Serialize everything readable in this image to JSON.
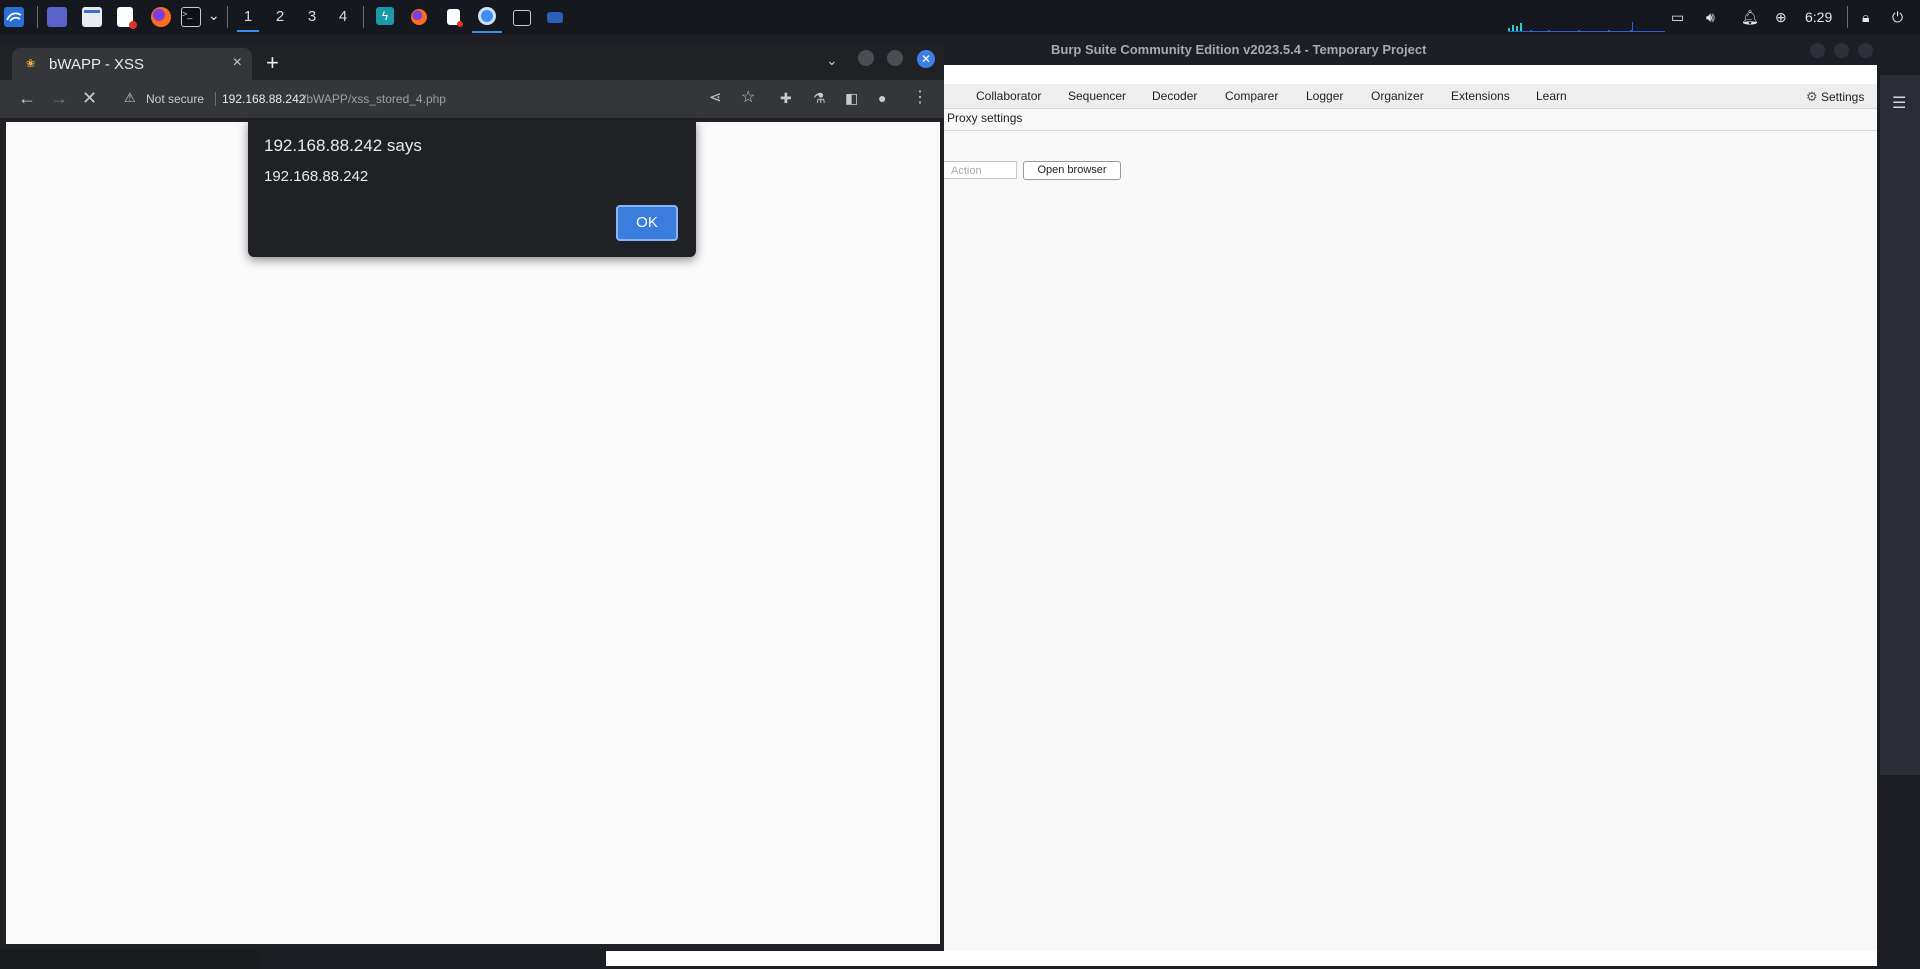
{
  "taskbar": {
    "workspaces": [
      "1",
      "2",
      "3",
      "4"
    ],
    "active_workspace": "1",
    "clock": "6:29",
    "launcher_icons": [
      "kali-menu-icon",
      "desktop-icon",
      "file-manager-icon",
      "text-editor-icon",
      "firefox-icon",
      "terminal-icon"
    ],
    "window_icons": [
      "burp-icon",
      "firefox-window-icon",
      "editor-window-icon",
      "chromium-window-icon",
      "terminal-window-icon",
      "folder-window-icon"
    ],
    "tray_icons": [
      "display-icon",
      "volume-icon",
      "bell-icon",
      "power-manager-icon",
      "lock-icon",
      "logout-icon"
    ]
  },
  "burp": {
    "title": "Burp Suite Community Edition v2023.5.4 - Temporary Project",
    "tabs": [
      "Collaborator",
      "Sequencer",
      "Decoder",
      "Comparer",
      "Logger",
      "Organizer",
      "Extensions",
      "Learn"
    ],
    "settings_label": "Settings",
    "subtab": "Proxy settings",
    "action_placeholder": "Action",
    "open_browser_label": "Open browser"
  },
  "chrome": {
    "tab_title": "bWAPP - XSS",
    "security_label": "Not secure",
    "url_host": "192.168.88.242",
    "url_path": "/bWAPP/xss_stored_4.php",
    "dialog": {
      "title": "192.168.88.242 says",
      "message": "192.168.88.242",
      "ok_label": "OK"
    }
  },
  "colors": {
    "accent": "#3b7ddd",
    "taskbar_bg": "#15181e",
    "chrome_toolbar": "#35363a",
    "burp_bg": "#f8f8f8"
  }
}
